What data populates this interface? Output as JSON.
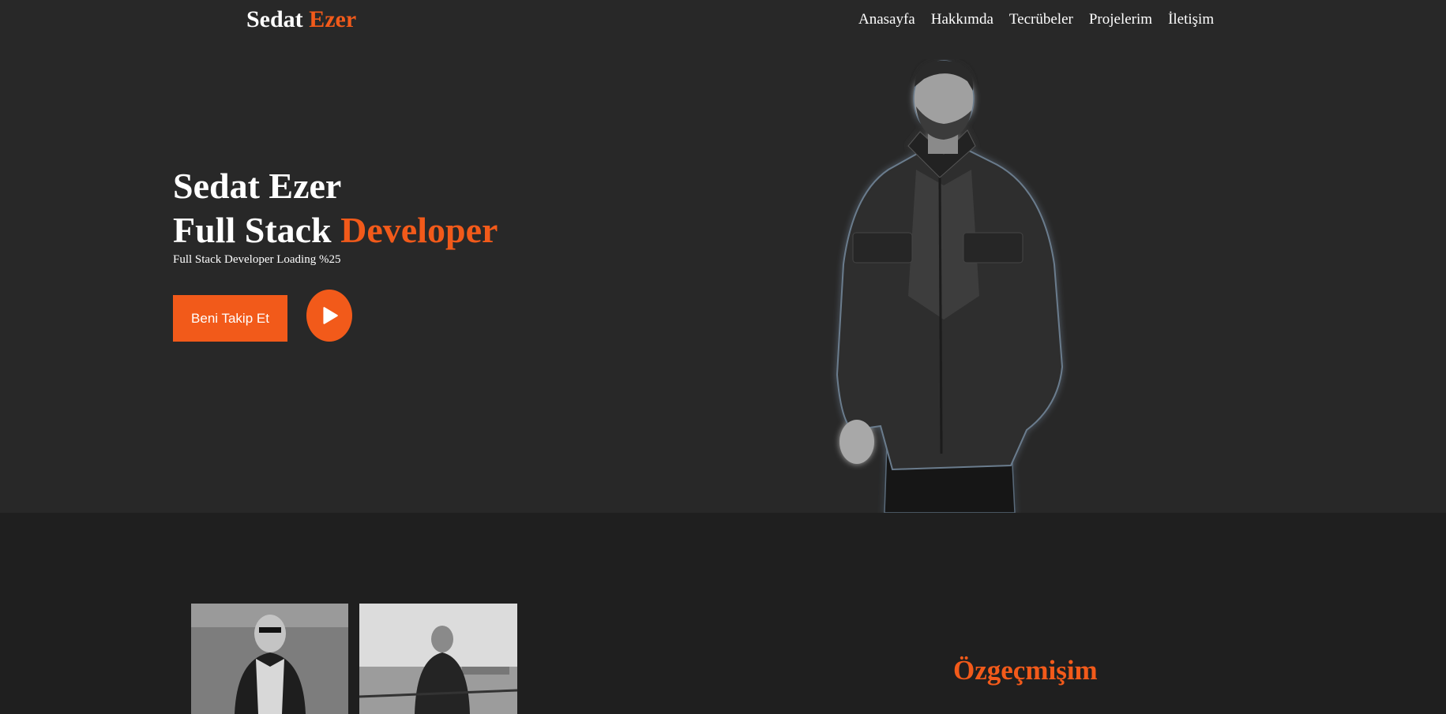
{
  "header": {
    "logo_first": "Sedat",
    "logo_accent": "Ezer",
    "nav": [
      "Anasayfa",
      "Hakkımda",
      "Tecrübeler",
      "Projelerim",
      "İletişim"
    ]
  },
  "hero": {
    "name": "Sedat Ezer",
    "role_prefix": "Full Stack",
    "role_accent": "Developer",
    "subtitle": "Full Stack Developer Loading %25",
    "follow_button": "Beni Takip Et",
    "play_icon": "play-icon"
  },
  "about": {
    "title": "Özgeçmişim"
  },
  "colors": {
    "accent": "#f25a1a",
    "hero_bg": "#282828",
    "section_bg": "#1f1f1f"
  }
}
